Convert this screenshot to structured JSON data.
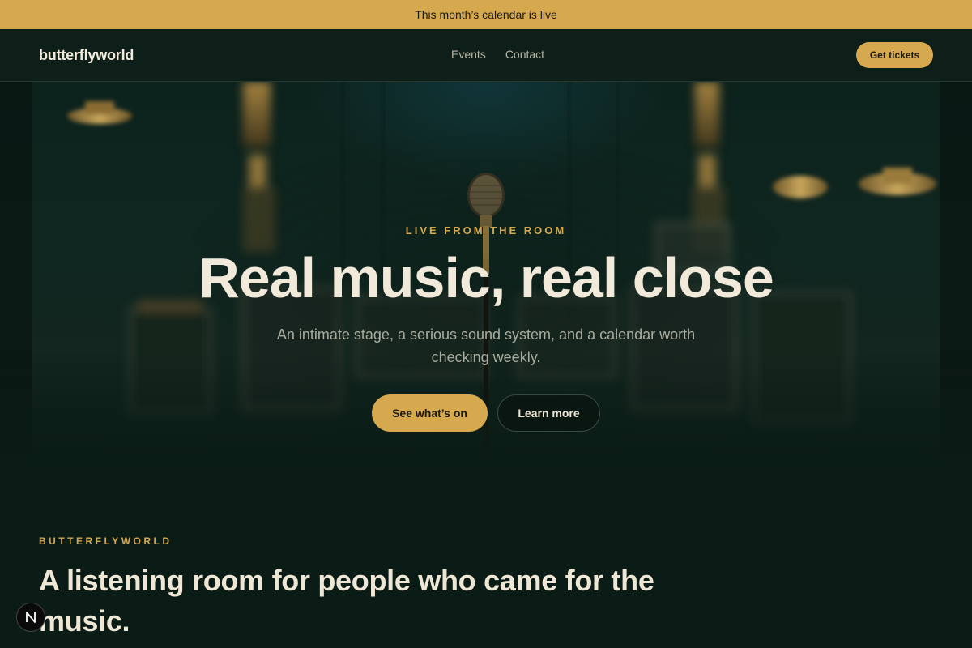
{
  "announcement": {
    "text": "This month’s calendar is live"
  },
  "header": {
    "logo": "butterflyworld",
    "nav": [
      {
        "label": "Events"
      },
      {
        "label": "Contact"
      }
    ],
    "cta_label": "Get tickets"
  },
  "hero": {
    "eyebrow": "LIVE FROM THE ROOM",
    "title": "Real music, real close",
    "subtitle": "An intimate stage, a serious sound system, and a calendar worth checking weekly.",
    "primary_button": "See what’s on",
    "secondary_button": "Learn more"
  },
  "intro": {
    "eyebrow": "BUTTERFLYWORLD",
    "title": "A listening room for people who came for the music."
  },
  "colors": {
    "accent": "#d6a94f",
    "background": "#0b1c16",
    "text": "#efe7d6"
  },
  "icons": {
    "badge": "next-logo-icon"
  }
}
